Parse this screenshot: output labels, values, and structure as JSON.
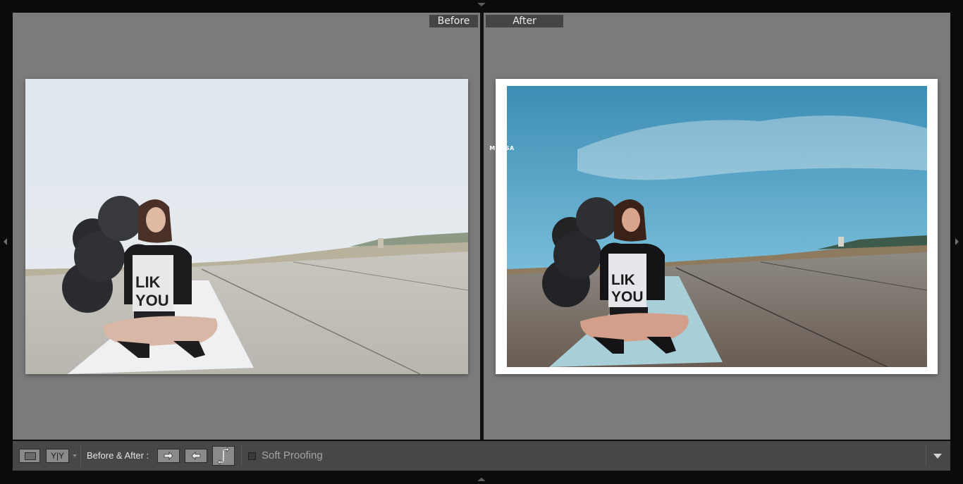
{
  "window": {
    "app": "Lightroom Develop - Before/After view"
  },
  "compare": {
    "before_label": "Before",
    "after_label": "After"
  },
  "photo": {
    "shirt_text_line1": "LIK",
    "shirt_text_line2": "YOU",
    "watermark_text": "MI OSA"
  },
  "toolbar": {
    "loupe_icon": "loupe-view-icon",
    "yy_label": "Y|Y",
    "before_after_label": "Before & After :",
    "copy_before_to_after_icon": "arrow-right-icon",
    "copy_after_to_before_icon": "arrow-left-icon",
    "swap_icon": "swap-arrows-icon",
    "soft_proofing_label": "Soft Proofing",
    "soft_proofing_checked": false,
    "menu_icon": "chevron-down-icon"
  },
  "colors": {
    "pane_bg": "#7b7b7b",
    "toolbar_bg": "#474747",
    "tag_bg": "#444444"
  }
}
